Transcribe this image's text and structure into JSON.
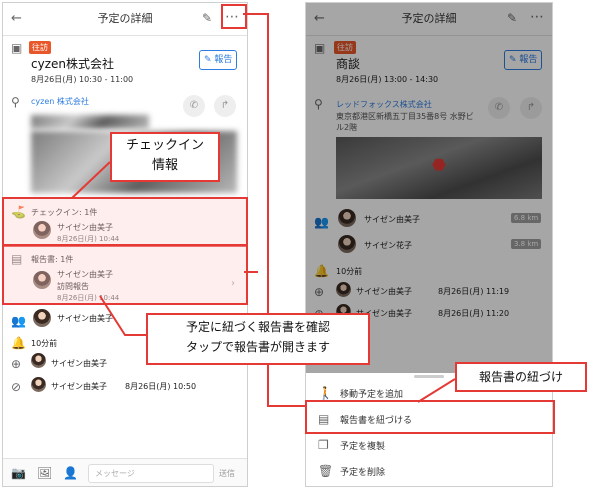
{
  "left": {
    "header_title": "予定の詳細",
    "tag": "往訪",
    "title": "cyzen株式会社",
    "datetime": "8月26日(月) 10:30 - 11:00",
    "report_button": "報告",
    "company": "cyzen 株式会社",
    "checkin_header": "チェックイン: 1件",
    "checkin_user": "サイゼン由美子",
    "checkin_time": "8月26日(月) 10:44",
    "report_header": "報告書: 1件",
    "report_user": "サイゼン由美子",
    "report_type": "訪問報告",
    "report_time": "8月26日(月) 10:44",
    "member": "サイゼン由美子",
    "reminder": "10分前",
    "act1_user": "サイゼン由美子",
    "act2_user": "サイゼン由美子",
    "act2_time": "8月26日(月) 10:50",
    "message_placeholder": "メッセージ",
    "send": "送信"
  },
  "right": {
    "header_title": "予定の詳細",
    "tag": "往訪",
    "title": "商談",
    "datetime": "8月26日(月) 13:00 - 14:30",
    "report_button": "報告",
    "company": "レッドフォックス株式会社",
    "address": "東京都港区新橋五丁目35番8号 水野ビル2階",
    "member1": "サイゼン由美子",
    "member1_km": "6.8 km",
    "member2": "サイゼン花子",
    "member2_km": "3.8 km",
    "reminder": "10分前",
    "act1_user": "サイゼン由美子",
    "act1_time": "8月26日(月) 11:19",
    "act2_user": "サイゼン由美子",
    "act2_time": "8月26日(月) 11:20",
    "menu": [
      "移動予定を追加",
      "報告書を紐づける",
      "予定を複製",
      "予定を削除"
    ]
  },
  "callouts": {
    "checkin_info": "チェックイン\n情報",
    "report_link_line1": "予定に紐づく報告書を確認",
    "report_link_line2": "タップで報告書が開きます",
    "link_report": "報告書の紐づけ"
  },
  "colors": {
    "accent_red": "#e53935",
    "tag_orange": "#e8572a",
    "link_blue": "#2f7de1"
  }
}
